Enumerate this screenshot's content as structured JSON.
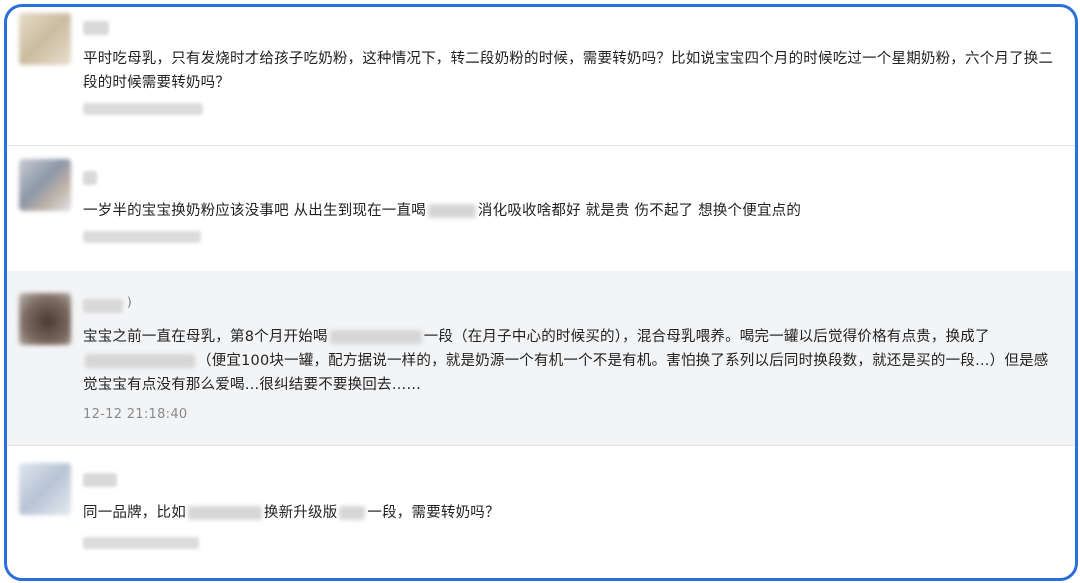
{
  "comments": [
    {
      "text": "平时吃母乳，只有发烧时才给孩子吃奶粉，这种情况下，转二段奶粉的时候，需要转奶吗？比如说宝宝四个月的时候吃过一个星期奶粉，六个月了换二段的时候需要转奶吗？"
    },
    {
      "text_a": "一岁半的宝宝换奶粉应该没事吧 从出生到现在一直喝",
      "text_b": "消化吸收啥都好 就是贵 伤不起了 想换个便宜点的"
    },
    {
      "name_suffix": ")",
      "text_a": "宝宝之前一直在母乳，第8个月开始喝",
      "text_b": "一段（在月子中心的时候买的），混合母乳喂养。喝完一罐以后觉得价格有点贵，换成了",
      "text_c": "（便宜100块一罐，配方据说一样的，就是奶源一个有机一个不是有机。害怕换了系列以后同时换段数，就还是买的一段…）但是感觉宝宝有点没有那么爱喝…很纠结要不要换回去……",
      "time": "12-12 21:18:40"
    },
    {
      "text_a": "同一品牌，比如",
      "text_b": "换新升级版",
      "text_c": "一段，需要转奶吗？"
    }
  ]
}
